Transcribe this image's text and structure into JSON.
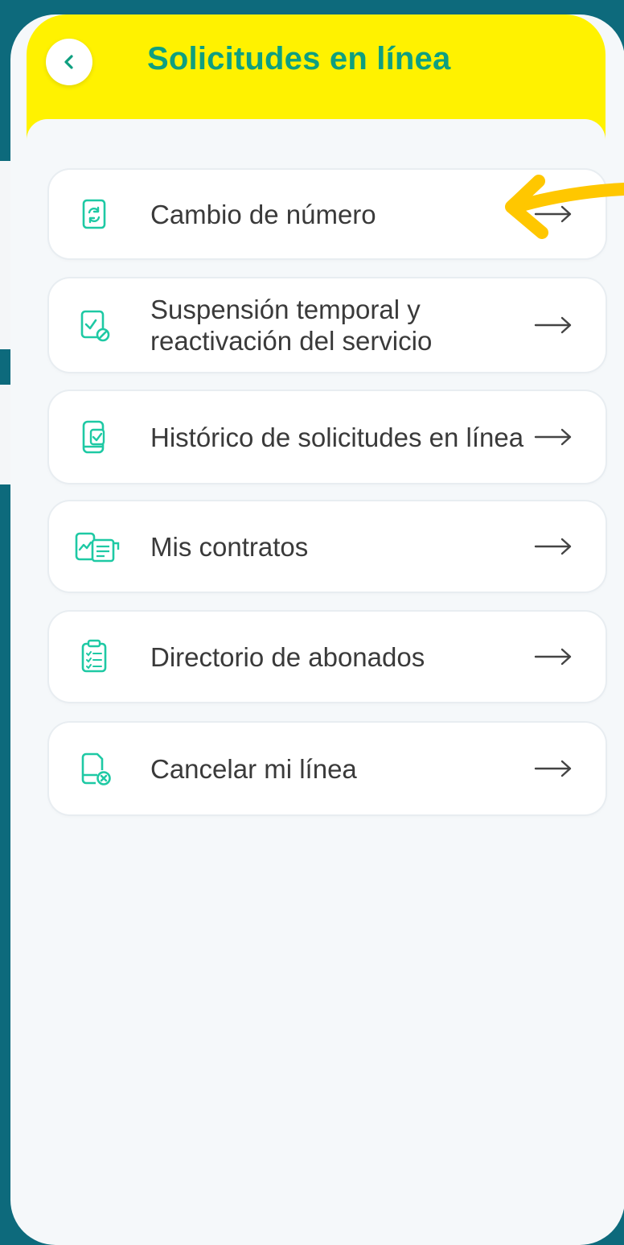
{
  "header": {
    "title": "Solicitudes en línea",
    "back_icon": "chevron-left-icon"
  },
  "colors": {
    "background": "#0d6a7c",
    "header": "#fff200",
    "title": "#0e9f80",
    "icon": "#1ec9a4",
    "pointer": "#ffc700"
  },
  "menu": {
    "items": [
      {
        "label": "Cambio de número",
        "icon": "phone-swap-icon"
      },
      {
        "label": "Suspensión temporal y reactivación del servicio",
        "icon": "document-block-icon"
      },
      {
        "label": "Histórico de solicitudes en línea",
        "icon": "mobile-history-icon"
      },
      {
        "label": "Mis contratos",
        "icon": "contracts-icon"
      },
      {
        "label": "Directorio de abonados",
        "icon": "clipboard-list-icon"
      },
      {
        "label": "Cancelar mi línea",
        "icon": "sim-cancel-icon"
      }
    ]
  },
  "annotation": {
    "icon": "pointer-arrow-icon"
  }
}
